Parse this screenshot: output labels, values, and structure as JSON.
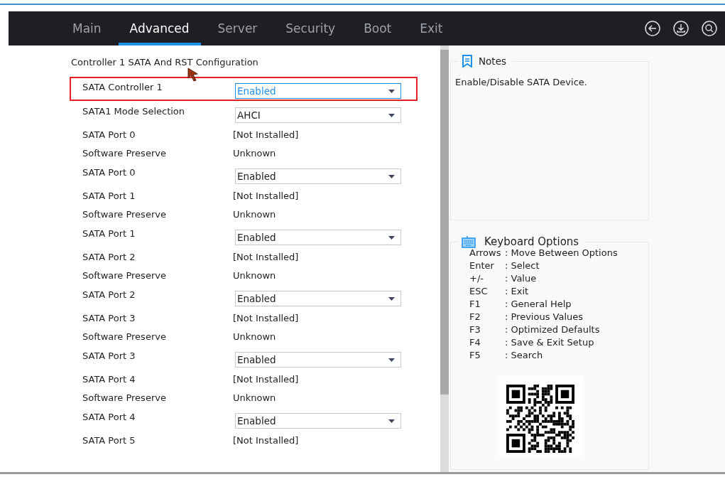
{
  "tabs": [
    {
      "label": "Main",
      "selected": false
    },
    {
      "label": "Advanced",
      "selected": true
    },
    {
      "label": "Server",
      "selected": false
    },
    {
      "label": "Security",
      "selected": false
    },
    {
      "label": "Boot",
      "selected": false
    },
    {
      "label": "Exit",
      "selected": false
    }
  ],
  "toolbar": [
    {
      "kind": "back"
    },
    {
      "kind": "save"
    },
    {
      "kind": "search"
    }
  ],
  "section_title": "Controller 1 SATA And RST Configuration",
  "settings": [
    {
      "kind": "select",
      "label": "SATA Controller 1",
      "value": "Enabled",
      "selected": true
    },
    {
      "kind": "select",
      "label": "SATA1 Mode Selection",
      "value": "AHCI",
      "selected": false
    },
    {
      "kind": "text",
      "label": "SATA Port 0",
      "value": "[Not Installed]",
      "selected": false
    },
    {
      "kind": "text",
      "label": "Software Preserve",
      "value": "Unknown",
      "selected": false
    },
    {
      "kind": "select",
      "label": "SATA Port 0",
      "value": "Enabled",
      "selected": false
    },
    {
      "kind": "text",
      "label": "SATA Port 1",
      "value": "[Not Installed]",
      "selected": false
    },
    {
      "kind": "text",
      "label": "Software Preserve",
      "value": "Unknown",
      "selected": false
    },
    {
      "kind": "select",
      "label": "SATA Port 1",
      "value": "Enabled",
      "selected": false
    },
    {
      "kind": "text",
      "label": "SATA Port 2",
      "value": "[Not Installed]",
      "selected": false
    },
    {
      "kind": "text",
      "label": "Software Preserve",
      "value": "Unknown",
      "selected": false
    },
    {
      "kind": "select",
      "label": "SATA Port 2",
      "value": "Enabled",
      "selected": false
    },
    {
      "kind": "text",
      "label": "SATA Port 3",
      "value": "[Not Installed]",
      "selected": false
    },
    {
      "kind": "text",
      "label": "Software Preserve",
      "value": "Unknown",
      "selected": false
    },
    {
      "kind": "select",
      "label": "SATA Port 3",
      "value": "Enabled",
      "selected": false
    },
    {
      "kind": "text",
      "label": "SATA Port 4",
      "value": "[Not Installed]",
      "selected": false
    },
    {
      "kind": "text",
      "label": "Software Preserve",
      "value": "Unknown",
      "selected": false
    },
    {
      "kind": "select",
      "label": "SATA Port 4",
      "value": "Enabled",
      "selected": false
    },
    {
      "kind": "text",
      "label": "SATA Port 5",
      "value": "[Not Installed]",
      "selected": false
    }
  ],
  "notes": {
    "title": "Notes",
    "text": "Enable/Disable SATA Device."
  },
  "keyboard_options": {
    "title": "Keyboard Options",
    "items": [
      {
        "key": "Arrows",
        "action": ": Move Between Options"
      },
      {
        "key": "Enter",
        "action": ": Select"
      },
      {
        "key": "+/-",
        "action": ": Value"
      },
      {
        "key": "ESC",
        "action": ": Exit"
      },
      {
        "key": "F1",
        "action": ": General Help"
      },
      {
        "key": "F2",
        "action": ": Previous Values"
      },
      {
        "key": "F3",
        "action": ": Optimized Defaults"
      },
      {
        "key": "F4",
        "action": ": Save & Exit Setup"
      },
      {
        "key": "F5",
        "action": ": Search"
      }
    ]
  }
}
